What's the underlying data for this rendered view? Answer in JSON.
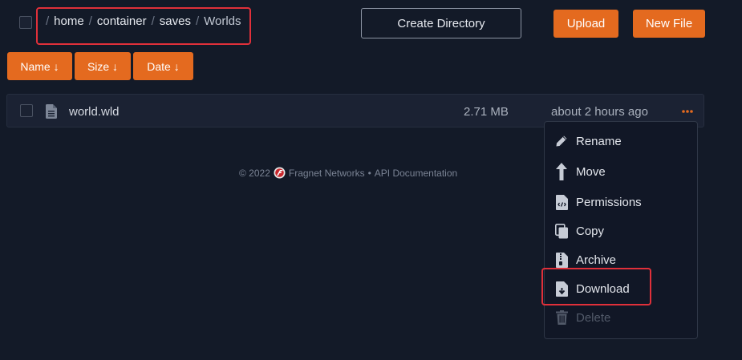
{
  "breadcrumb": {
    "items": [
      {
        "label": "home"
      },
      {
        "label": "container"
      },
      {
        "label": "saves"
      },
      {
        "label": "Worlds"
      }
    ],
    "separator": "/"
  },
  "toolbar": {
    "create_directory_label": "Create Directory",
    "upload_label": "Upload",
    "new_file_label": "New File"
  },
  "sort": {
    "name_label": "Name ↓",
    "size_label": "Size ↓",
    "date_label": "Date ↓"
  },
  "files": [
    {
      "name": "world.wld",
      "size": "2.71 MB",
      "modified": "about 2 hours ago"
    }
  ],
  "context_menu": {
    "items": [
      {
        "label": "Rename",
        "icon": "pencil-icon"
      },
      {
        "label": "Move",
        "icon": "arrow-up-icon"
      },
      {
        "label": "Permissions",
        "icon": "file-code-icon"
      },
      {
        "label": "Copy",
        "icon": "copy-icon"
      },
      {
        "label": "Archive",
        "icon": "file-archive-icon"
      },
      {
        "label": "Download",
        "icon": "file-download-icon"
      },
      {
        "label": "Delete",
        "icon": "trash-icon",
        "disabled": true
      }
    ]
  },
  "footer": {
    "copyright": "© 2022",
    "company": "Fragnet Networks",
    "separator": "•",
    "api_link": "API Documentation"
  },
  "colors": {
    "background": "#131a28",
    "accent": "#e46a1f",
    "annotation": "#e0303a"
  }
}
